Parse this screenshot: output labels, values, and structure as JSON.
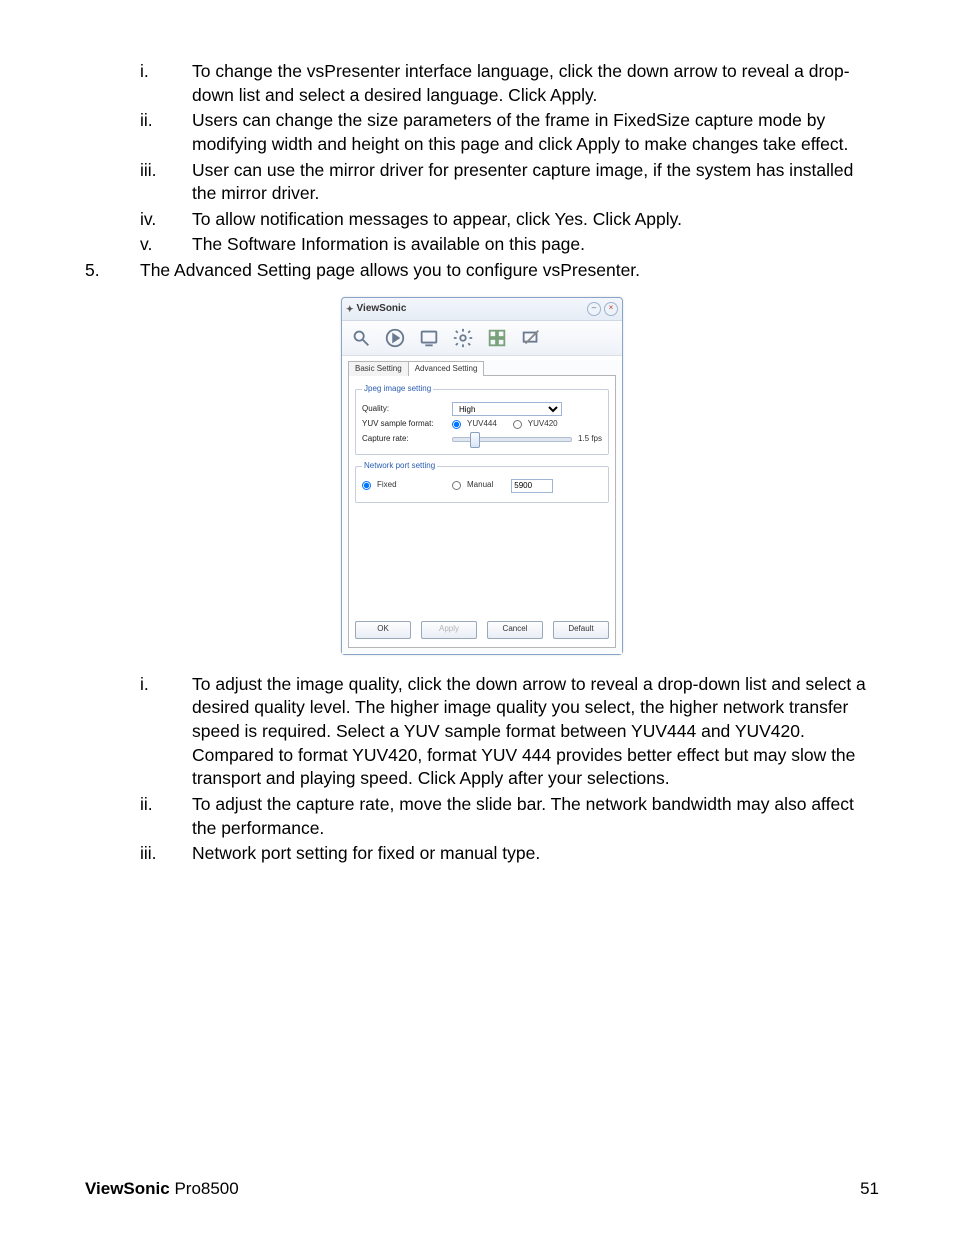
{
  "top_list": [
    {
      "num": "i.",
      "text": "To change the vsPresenter interface language, click the down arrow to reveal a drop-down list and select a desired language. Click Apply."
    },
    {
      "num": "ii.",
      "text": "Users can change the size parameters of the frame in FixedSize capture mode by modifying width and height on this page and click Apply to make changes take effect."
    },
    {
      "num": "iii.",
      "text": "User can use the mirror driver for presenter capture image, if the system has installed the mirror driver."
    },
    {
      "num": "iv.",
      "text": "To allow notification messages to appear, click Yes. Click Apply."
    },
    {
      "num": "v.",
      "text": "The Software Information is available on this page."
    }
  ],
  "item5": {
    "num": "5.",
    "text": "The Advanced Setting page allows you to configure vsPresenter."
  },
  "dialog": {
    "title": "ViewSonic",
    "tabs": {
      "basic": "Basic Setting",
      "advanced": "Advanced Setting"
    },
    "jpeg_legend": "Jpeg image setting",
    "quality_label": "Quality:",
    "quality_value": "High",
    "yuv_label": "YUV sample format:",
    "yuv444": "YUV444",
    "yuv420": "YUV420",
    "capture_label": "Capture rate:",
    "fps": "1.5 fps",
    "net_legend": "Network port setting",
    "fixed": "Fixed",
    "manual": "Manual",
    "port": "5900",
    "ok": "OK",
    "apply": "Apply",
    "cancel": "Cancel",
    "default": "Default"
  },
  "bottom_list": [
    {
      "num": "i.",
      "text": "To adjust the image quality, click the down arrow to reveal a drop-down list and select a desired quality level. The higher image quality you select, the higher network transfer speed is required. Select a YUV sample format between YUV444 and YUV420. Compared to format YUV420, format YUV 444 provides better effect but may slow the transport and playing speed. Click Apply after your selections."
    },
    {
      "num": "ii.",
      "text": "To adjust the capture rate, move the slide bar. The network bandwidth may also affect the performance."
    },
    {
      "num": "iii.",
      "text": "Network port setting for fixed or manual type."
    }
  ],
  "footer": {
    "brand_bold": "ViewSonic",
    "brand_rest": " Pro8500",
    "page": "51"
  }
}
